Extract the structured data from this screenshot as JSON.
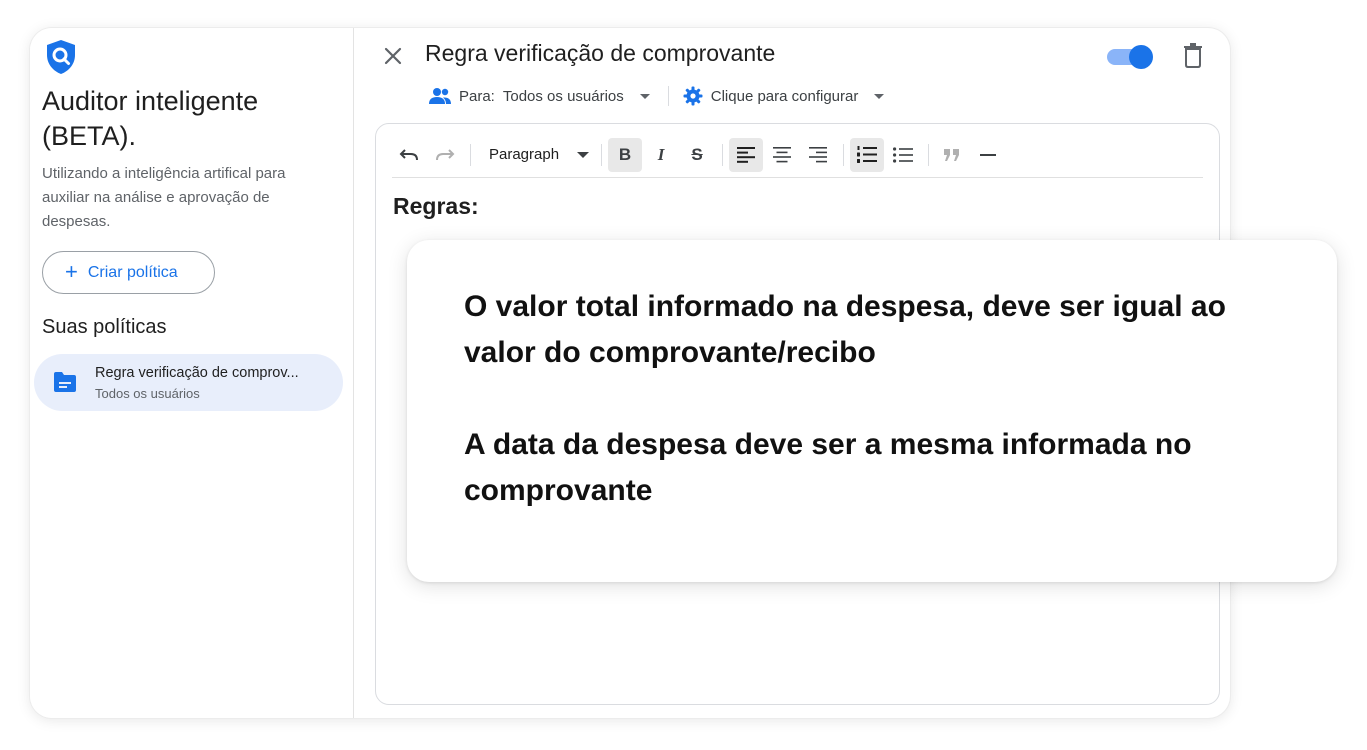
{
  "sidebar": {
    "app_title": "Auditor inteligente (BETA).",
    "description": "Utilizando a inteligência artifical para auxiliar na análise e aprovação de despesas.",
    "create_button_label": "Criar política",
    "section_title": "Suas políticas",
    "policies": [
      {
        "title": "Regra verificação de comprov...",
        "subtitle": "Todos os usuários",
        "icon": "folder-icon"
      }
    ]
  },
  "editor": {
    "title": "Regra verificação de comprovante",
    "enabled": true,
    "audience_label": "Para:",
    "audience_value": "Todos os usuários",
    "configure_label": "Clique para configurar",
    "toolbar": {
      "paragraph_style": "Paragraph",
      "bold_label": "B",
      "italic_label": "I",
      "strike_label": "S"
    },
    "heading": "Regras:"
  },
  "overlay": {
    "rules": [
      "O valor total informado na despesa, deve ser igual ao valor do comprovante/recibo",
      "A data da despesa deve ser a mesma informada no comprovante"
    ]
  },
  "colors": {
    "accent": "#1a73e8",
    "selected_item_bg": "#e8eefb",
    "toggle_track": "#8ab4f8"
  }
}
